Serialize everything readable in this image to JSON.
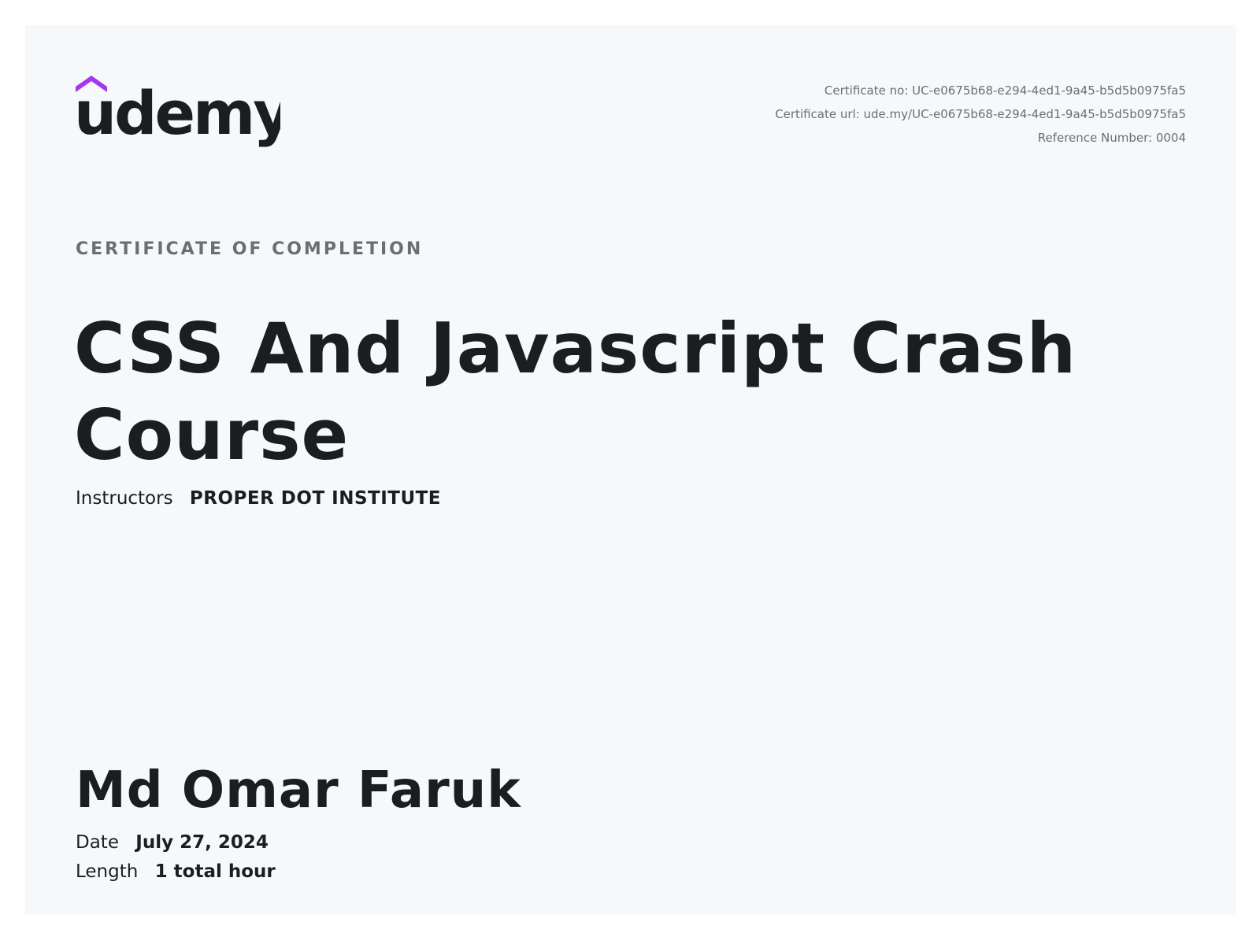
{
  "brand": {
    "name": "udemy",
    "accent_color": "#a435f0",
    "text_color": "#1c1d1f"
  },
  "meta": {
    "certificate_no": "Certificate no: UC-e0675b68-e294-4ed1-9a45-b5d5b0975fa5",
    "certificate_url": "Certificate url: ude.my/UC-e0675b68-e294-4ed1-9a45-b5d5b0975fa5",
    "reference_number": "Reference Number: 0004"
  },
  "certificate": {
    "kicker": "CERTIFICATE OF COMPLETION",
    "course_title": "CSS And Javascript Crash Course",
    "instructors_label": "Instructors",
    "instructors_value": "PROPER DOT INSTITUTE",
    "recipient_name": "Md Omar Faruk",
    "date_label": "Date",
    "date_value": "July 27, 2024",
    "length_label": "Length",
    "length_value": "1 total hour"
  }
}
